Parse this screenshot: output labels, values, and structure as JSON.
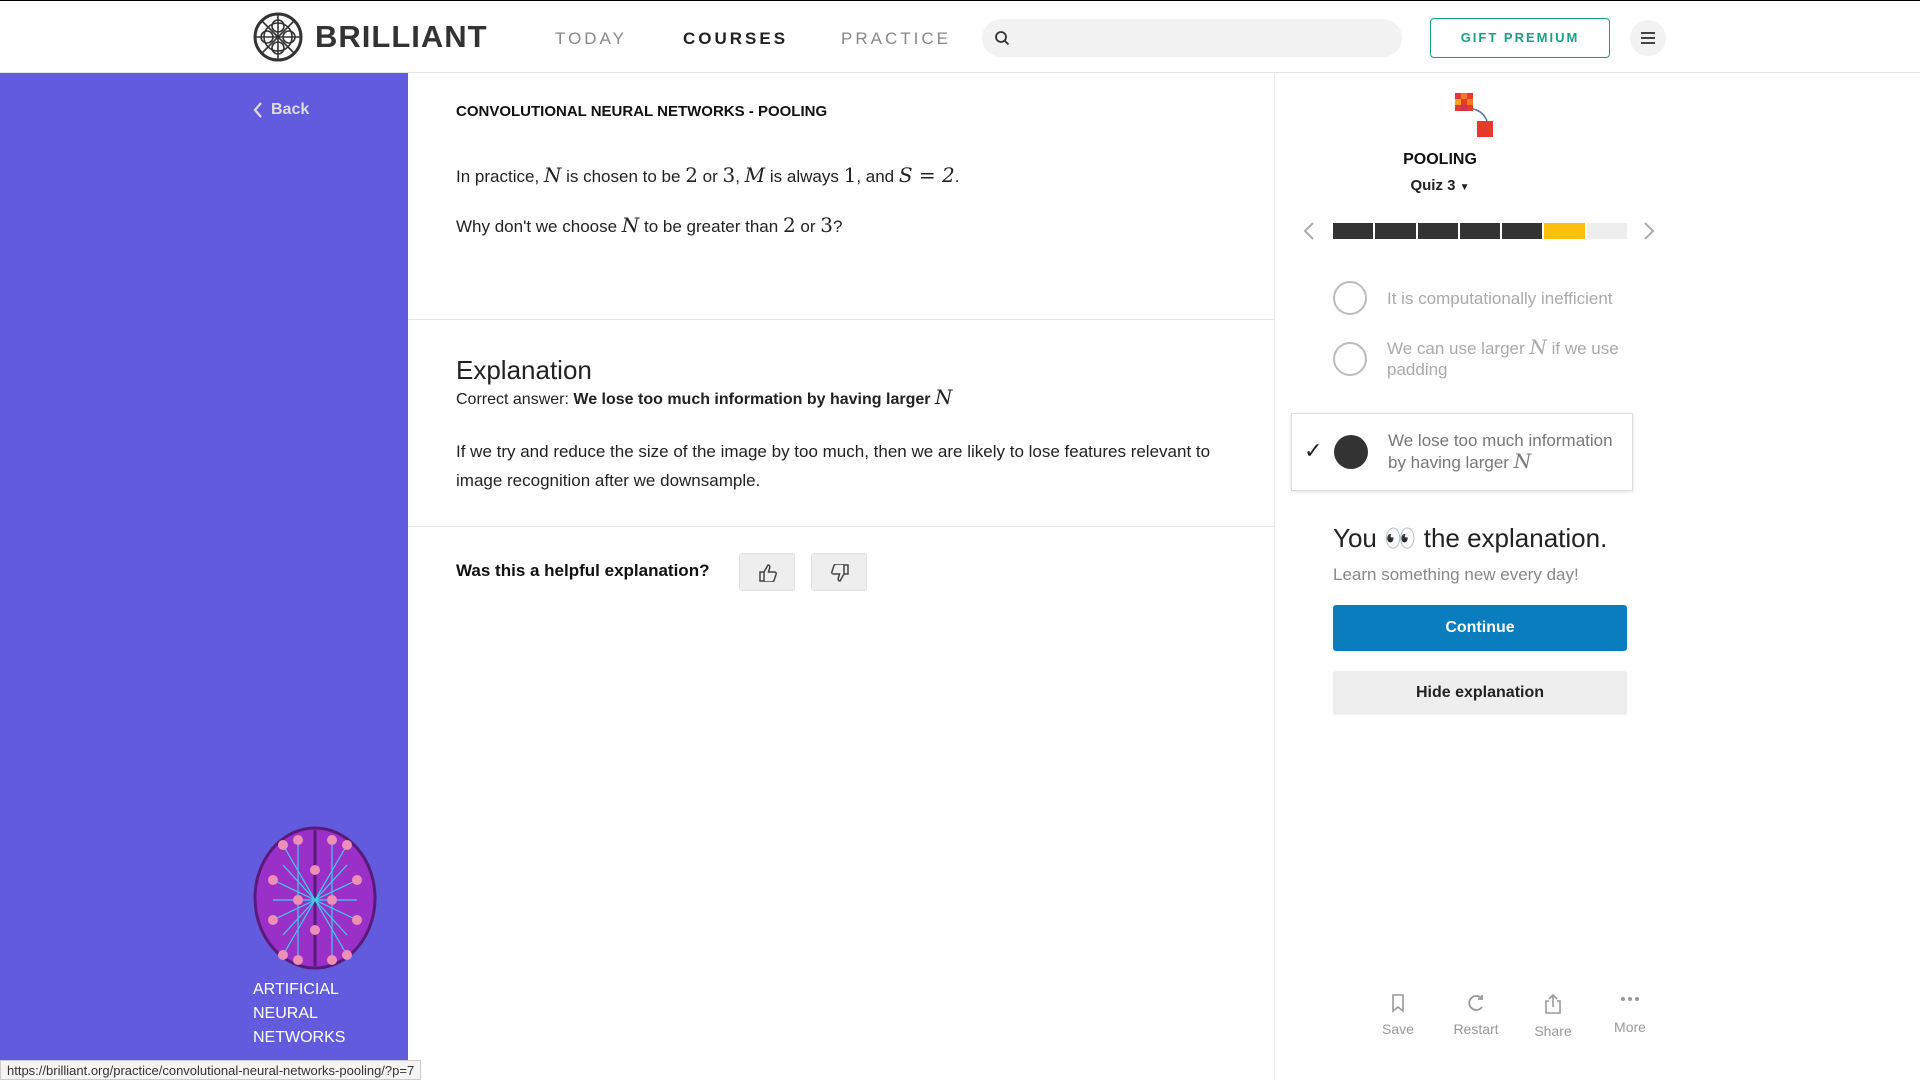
{
  "header": {
    "brand": "BRILLIANT",
    "nav": [
      "TODAY",
      "COURSES",
      "PRACTICE"
    ],
    "active_nav": "COURSES",
    "search_placeholder": "",
    "gift_label": "GIFT PREMIUM"
  },
  "sidebar": {
    "back_label": "Back",
    "course_name": "ARTIFICIAL NEURAL NETWORKS",
    "bg_color": "#635bdd"
  },
  "main": {
    "breadcrumb": "CONVOLUTIONAL NEURAL NETWORKS - POOLING",
    "question": {
      "line1": [
        "In practice, ",
        "N",
        " is chosen to be ",
        "2",
        " or ",
        "3",
        ", ",
        "M",
        " is always ",
        "1",
        ", and ",
        "S = 2",
        "."
      ],
      "line2": [
        "Why don't we choose ",
        "N",
        " to be greater than ",
        "2",
        " or ",
        "3",
        "?"
      ]
    },
    "explanation": {
      "title": "Explanation",
      "correct_prefix": "Correct answer: ",
      "correct_answer": "We lose too much information by having larger",
      "correct_var": "N",
      "body": "If we try and reduce the size of the image by too much, then we are likely to lose features relevant to image recognition after we downsample."
    },
    "feedback_question": "Was this a helpful explanation?"
  },
  "right_panel": {
    "topic": "POOLING",
    "quiz": "Quiz 3",
    "progress": {
      "segments": [
        "done",
        "done",
        "done",
        "done",
        "done",
        "current",
        "todo"
      ],
      "colors": {
        "done": "#333333",
        "current": "#fbbf0f",
        "todo": "#eeeeee"
      }
    },
    "options": [
      {
        "text": "It is computationally inefficient",
        "selected": false
      },
      {
        "text_before": "We can use larger ",
        "var": "N",
        "text_after": " if we use padding",
        "selected": false
      },
      {
        "text_before": "We lose too much information by having larger ",
        "var": "N",
        "selected": true
      }
    ],
    "you_prefix": "You",
    "you_emoji": "👀",
    "you_suffix": "the explanation.",
    "learn": "Learn something new every day!",
    "continue_label": "Continue",
    "hide_label": "Hide explanation",
    "tools": [
      "Save",
      "Restart",
      "Share",
      "More"
    ],
    "accent": "#0a7dbf"
  },
  "status_url": "https://brilliant.org/practice/convolutional-neural-networks-pooling/?p=7"
}
